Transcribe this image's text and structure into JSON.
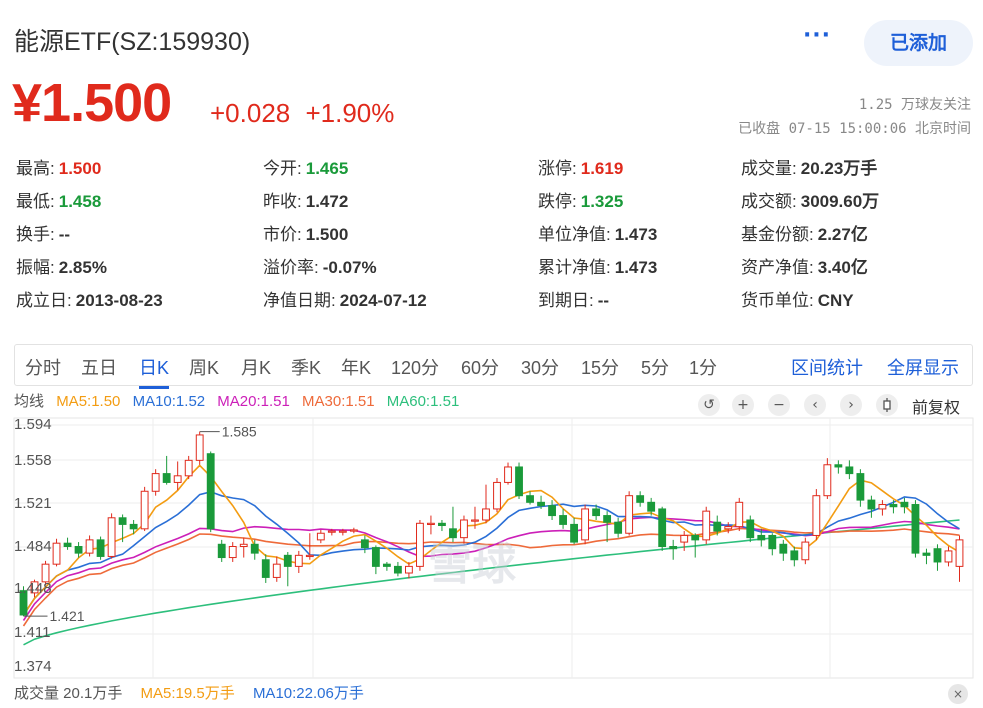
{
  "header": {
    "title": "能源ETF(SZ:159930)",
    "more_label": "···",
    "add_button_label": "已添加"
  },
  "price": {
    "current": "¥1.500",
    "change": "+0.028",
    "change_pct": "+1.90%",
    "followers": "1.25 万球友关注",
    "status_time": "已收盘 07-15 15:00:06 北京时间"
  },
  "quote": [
    {
      "label": "最高:",
      "value": "1.500",
      "tone": "up"
    },
    {
      "label": "今开:",
      "value": "1.465",
      "tone": "down"
    },
    {
      "label": "涨停:",
      "value": "1.619",
      "tone": "up"
    },
    {
      "label": "成交量:",
      "value": "20.23万手",
      "tone": "flat"
    },
    {
      "label": "最低:",
      "value": "1.458",
      "tone": "down"
    },
    {
      "label": "昨收:",
      "value": "1.472",
      "tone": "flat"
    },
    {
      "label": "跌停:",
      "value": "1.325",
      "tone": "down"
    },
    {
      "label": "成交额:",
      "value": "3009.60万",
      "tone": "flat"
    },
    {
      "label": "换手:",
      "value": "--",
      "tone": "flat"
    },
    {
      "label": "市价:",
      "value": "1.500",
      "tone": "flat"
    },
    {
      "label": "单位净值:",
      "value": "1.473",
      "tone": "flat"
    },
    {
      "label": "基金份额:",
      "value": "2.27亿",
      "tone": "flat"
    },
    {
      "label": "振幅:",
      "value": "2.85%",
      "tone": "flat"
    },
    {
      "label": "溢价率:",
      "value": "-0.07%",
      "tone": "flat"
    },
    {
      "label": "累计净值:",
      "value": "1.473",
      "tone": "flat"
    },
    {
      "label": "资产净值:",
      "value": "3.40亿",
      "tone": "flat"
    },
    {
      "label": "成立日:",
      "value": "2013-08-23",
      "tone": "flat"
    },
    {
      "label": "净值日期:",
      "value": "2024-07-12",
      "tone": "flat"
    },
    {
      "label": "到期日:",
      "value": "--",
      "tone": "flat"
    },
    {
      "label": "货币单位:",
      "value": "CNY",
      "tone": "flat"
    }
  ],
  "tabs": [
    "分时",
    "五日",
    "日K",
    "周K",
    "月K",
    "季K",
    "年K",
    "120分",
    "60分",
    "30分",
    "15分",
    "5分",
    "1分"
  ],
  "active_tab": "日K",
  "tab_links": {
    "interval_stats": "区间统计",
    "fullscreen": "全屏显示"
  },
  "ma_legend": {
    "label": "均线",
    "ma5": "MA5:1.50",
    "ma10": "MA10:1.52",
    "ma20": "MA20:1.51",
    "ma30": "MA30:1.51",
    "ma60": "MA60:1.51"
  },
  "toolbar": {
    "reset_icon": "↺",
    "zoom_in_icon": "+",
    "zoom_out_icon": "−",
    "prev_icon": "‹",
    "next_icon": "›",
    "candle_icon": "candlestick-icon",
    "adjust_label": "前复权"
  },
  "colors": {
    "up": "#e02a1c",
    "down": "#1a9a3a",
    "ma5": "#f39c12",
    "ma10": "#2a6fd6",
    "ma20": "#cc1fb8",
    "ma30": "#ee6a3a",
    "ma60": "#2dbf7c",
    "accent": "#1e5fd8"
  },
  "chart_data": {
    "type": "candlestick",
    "y_ticks": [
      "1.594",
      "1.558",
      "1.521",
      "1.484",
      "1.448",
      "1.411",
      "1.374"
    ],
    "ylim": [
      1.374,
      1.594
    ],
    "annotations": {
      "high": "1.585",
      "low": "1.421"
    },
    "candles": [
      [
        1.444,
        1.422,
        1.448,
        1.421
      ],
      [
        1.442,
        1.452,
        1.454,
        1.438
      ],
      [
        1.452,
        1.468,
        1.471,
        1.449
      ],
      [
        1.468,
        1.487,
        1.491,
        1.466
      ],
      [
        1.487,
        1.484,
        1.492,
        1.481
      ],
      [
        1.484,
        1.478,
        1.488,
        1.474
      ],
      [
        1.478,
        1.49,
        1.494,
        1.475
      ],
      [
        1.49,
        1.475,
        1.493,
        1.472
      ],
      [
        1.475,
        1.51,
        1.514,
        1.473
      ],
      [
        1.51,
        1.504,
        1.513,
        1.488
      ],
      [
        1.504,
        1.5,
        1.508,
        1.495
      ],
      [
        1.5,
        1.534,
        1.538,
        1.498
      ],
      [
        1.534,
        1.55,
        1.554,
        1.53
      ],
      [
        1.55,
        1.542,
        1.566,
        1.54
      ],
      [
        1.542,
        1.548,
        1.561,
        1.535
      ],
      [
        1.548,
        1.562,
        1.566,
        1.545
      ],
      [
        1.562,
        1.585,
        1.588,
        1.558
      ],
      [
        1.568,
        1.5,
        1.57,
        1.497
      ],
      [
        1.486,
        1.474,
        1.49,
        1.47
      ],
      [
        1.474,
        1.484,
        1.488,
        1.47
      ],
      [
        1.484,
        1.486,
        1.492,
        1.474
      ],
      [
        1.486,
        1.478,
        1.49,
        1.472
      ],
      [
        1.472,
        1.456,
        1.477,
        1.451
      ],
      [
        1.456,
        1.468,
        1.475,
        1.452
      ],
      [
        1.476,
        1.466,
        1.479,
        1.448
      ],
      [
        1.466,
        1.476,
        1.48,
        1.46
      ],
      [
        1.476,
        1.476,
        1.496,
        1.472
      ],
      [
        1.49,
        1.496,
        1.499,
        1.487
      ],
      [
        1.498,
        1.498,
        1.5,
        1.494
      ],
      [
        1.498,
        1.498,
        1.5,
        1.494
      ],
      [
        1.498,
        1.499,
        1.501,
        1.496
      ],
      [
        1.49,
        1.483,
        1.494,
        1.478
      ],
      [
        1.483,
        1.466,
        1.485,
        1.459
      ],
      [
        1.468,
        1.466,
        1.47,
        1.462
      ],
      [
        1.466,
        1.46,
        1.47,
        1.457
      ],
      [
        1.46,
        1.466,
        1.47,
        1.455
      ],
      [
        1.466,
        1.505,
        1.508,
        1.462
      ],
      [
        1.505,
        1.505,
        1.512,
        1.495
      ],
      [
        1.505,
        1.503,
        1.508,
        1.498
      ],
      [
        1.5,
        1.492,
        1.52,
        1.488
      ],
      [
        1.492,
        1.508,
        1.512,
        1.486
      ],
      [
        1.508,
        1.508,
        1.52,
        1.5
      ],
      [
        1.508,
        1.518,
        1.54,
        1.505
      ],
      [
        1.518,
        1.542,
        1.546,
        1.515
      ],
      [
        1.542,
        1.556,
        1.56,
        1.54
      ],
      [
        1.556,
        1.53,
        1.56,
        1.527
      ],
      [
        1.53,
        1.524,
        1.534,
        1.522
      ],
      [
        1.524,
        1.521,
        1.53,
        1.518
      ],
      [
        1.521,
        1.512,
        1.526,
        1.508
      ],
      [
        1.512,
        1.504,
        1.518,
        1.5
      ],
      [
        1.504,
        1.488,
        1.51,
        1.486
      ],
      [
        1.49,
        1.518,
        1.522,
        1.486
      ],
      [
        1.518,
        1.512,
        1.522,
        1.508
      ],
      [
        1.512,
        1.506,
        1.516,
        1.488
      ],
      [
        1.506,
        1.496,
        1.51,
        1.492
      ],
      [
        1.496,
        1.53,
        1.534,
        1.494
      ],
      [
        1.53,
        1.524,
        1.534,
        1.52
      ],
      [
        1.524,
        1.516,
        1.528,
        1.512
      ],
      [
        1.518,
        1.484,
        1.52,
        1.48
      ],
      [
        1.484,
        1.482,
        1.49,
        1.472
      ],
      [
        1.488,
        1.494,
        1.498,
        1.48
      ],
      [
        1.494,
        1.49,
        1.496,
        1.474
      ],
      [
        1.49,
        1.516,
        1.52,
        1.486
      ],
      [
        1.506,
        1.498,
        1.512,
        1.494
      ],
      [
        1.5,
        1.502,
        1.506,
        1.496
      ],
      [
        1.502,
        1.524,
        1.528,
        1.498
      ],
      [
        1.508,
        1.492,
        1.512,
        1.488
      ],
      [
        1.494,
        1.49,
        1.5,
        1.484
      ],
      [
        1.494,
        1.482,
        1.496,
        1.476
      ],
      [
        1.486,
        1.478,
        1.49,
        1.471
      ],
      [
        1.48,
        1.472,
        1.484,
        1.466
      ],
      [
        1.472,
        1.488,
        1.492,
        1.468
      ],
      [
        1.494,
        1.53,
        1.536,
        1.49
      ],
      [
        1.53,
        1.558,
        1.564,
        1.527
      ],
      [
        1.558,
        1.556,
        1.562,
        1.55
      ],
      [
        1.556,
        1.55,
        1.562,
        1.545
      ],
      [
        1.55,
        1.526,
        1.554,
        1.52
      ],
      [
        1.526,
        1.518,
        1.53,
        1.51
      ],
      [
        1.518,
        1.522,
        1.526,
        1.512
      ],
      [
        1.522,
        1.52,
        1.526,
        1.514
      ],
      [
        1.524,
        1.52,
        1.528,
        1.514
      ],
      [
        1.522,
        1.478,
        1.526,
        1.474
      ],
      [
        1.478,
        1.476,
        1.482,
        1.468
      ],
      [
        1.482,
        1.47,
        1.486,
        1.462
      ],
      [
        1.47,
        1.48,
        1.484,
        1.466
      ],
      [
        1.466,
        1.49,
        1.494,
        1.452
      ]
    ]
  },
  "volume": {
    "label": "成交量 20.1万手",
    "ma5": "MA5:19.5万手",
    "ma10": "MA10:22.06万手",
    "close_icon": "×"
  },
  "watermark": "雪球"
}
